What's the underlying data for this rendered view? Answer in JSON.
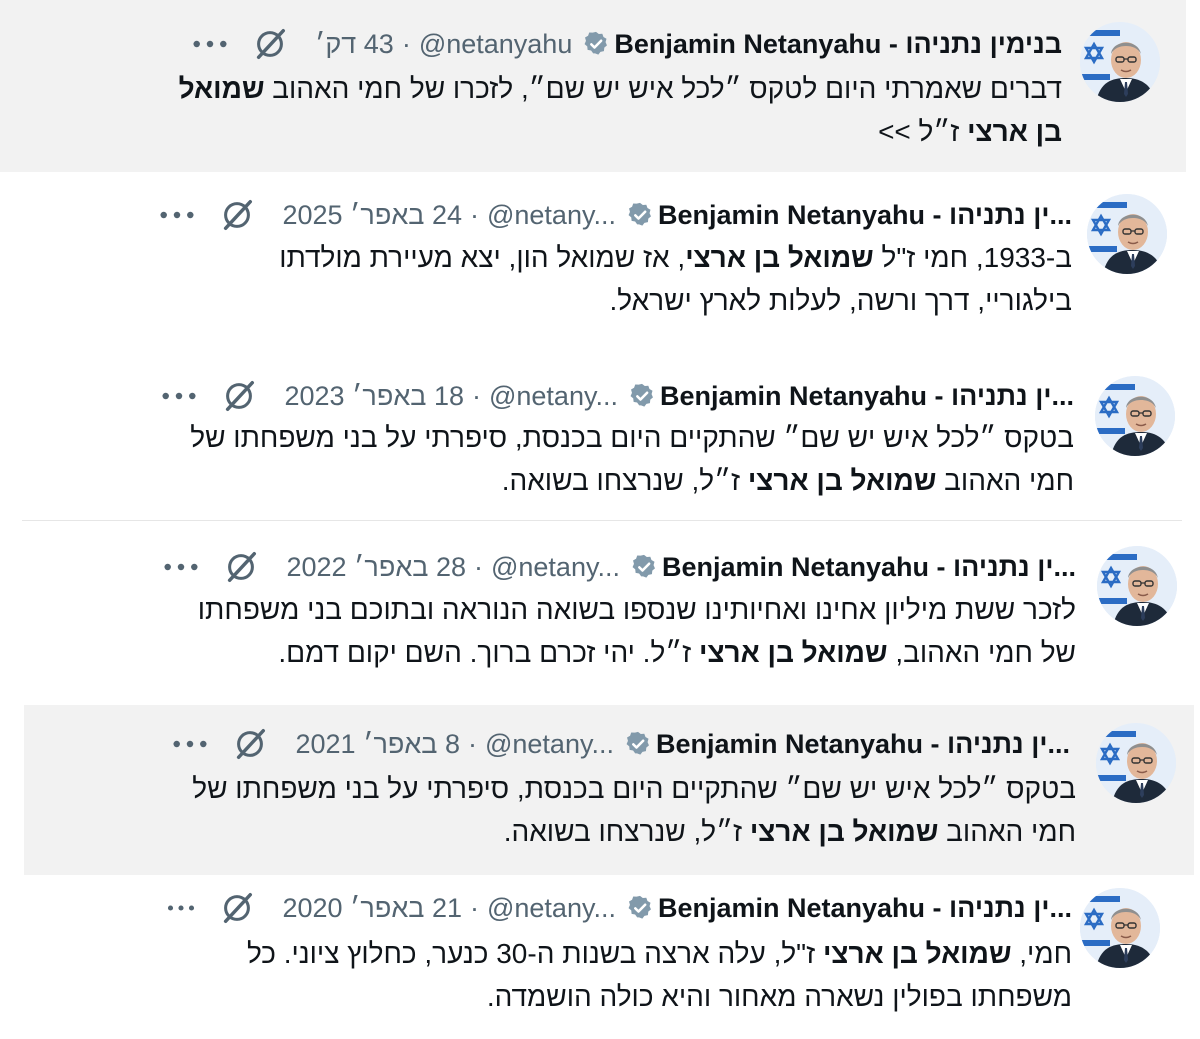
{
  "author": {
    "name_full": "בנימין נתניהו - Benjamin Netanyahu",
    "name_truncated": "...ין נתניהו - Benjamin Netanyahu",
    "handle_full": "@netanyahu",
    "handle_short": "@netany...",
    "handle_mid": "@netany..."
  },
  "colors": {
    "verified": "#829aab",
    "text": "#0f1419",
    "muted": "#536471",
    "shade": "#f2f2f2"
  },
  "icons": {
    "verified": "verified-badge-icon",
    "grok": "grok-icon",
    "more": "more-icon"
  },
  "tweets": [
    {
      "date": "43 דק׳",
      "t1": "דברים שאמרתי היום לטקס ״לכל איש יש שם״, לזכרו של חמי האהוב ",
      "t1b": "שמואל",
      "t2b": "בן ארצי",
      "t2": " ז״ל >>"
    },
    {
      "date": "24 באפר׳ 2025",
      "t1a": "ב-1933, חמי ז\"ל ",
      "t1b": "שמואל בן ארצי",
      "t1c": ", אז שמואל הון, יצא מעיירת מולדתו",
      "t2": "בילגוריי, דרך ורשה, לעלות לארץ ישראל."
    },
    {
      "date": "18 באפר׳ 2023",
      "t1": "בטקס ״לכל איש יש שם״ שהתקיים היום בכנסת, סיפרתי על בני משפחתו של",
      "t2a": "חמי האהוב ",
      "t2b": "שמואל בן ארצי",
      "t2c": " ז״ל, שנרצחו בשואה."
    },
    {
      "date": "28 באפר׳ 2022",
      "t1": "לזכר ששת מיליון אחינו ואחיותינו שנספו בשואה הנוראה ובתוכם בני משפחתו",
      "t2a": "של חמי האהוב, ",
      "t2b": "שמואל בן ארצי",
      "t2c": " ז״ל. יהי זכרם ברוך. השם יקום דמם."
    },
    {
      "date": "8 באפר׳ 2021",
      "t1": "בטקס ״לכל איש יש שם״ שהתקיים היום בכנסת, סיפרתי על בני משפחתו של",
      "t2a": "חמי האהוב ",
      "t2b": "שמואל בן ארצי",
      "t2c": " ז״ל, שנרצחו בשואה."
    },
    {
      "date": "21 באפר׳ 2020",
      "t1a": "חמי, ",
      "t1b": "שמואל בן ארצי",
      "t1c": " ז\"ל, עלה ארצה בשנות ה-30  כנער, כחלוץ ציוני. כל",
      "t2": "משפחתו בפולין נשארה מאחור והיא כולה הושמדה."
    }
  ]
}
